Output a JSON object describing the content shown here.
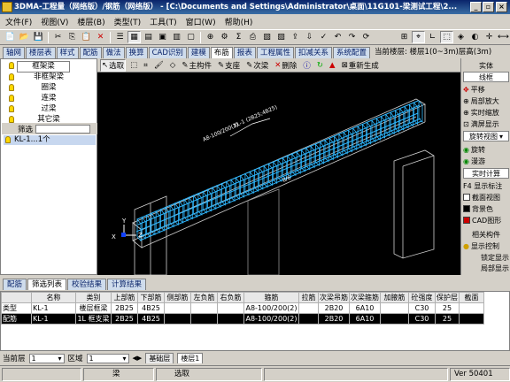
{
  "window": {
    "title": "3DMA-工程量（网络版）/钢筋（网络版） - [C:\\Documents and Settings\\Administrator\\桌面\\11G101-梁测试工程\\2...",
    "minimize": "_",
    "restore": "▫",
    "close": "×"
  },
  "menu": {
    "items": [
      "文件(F)",
      "视图(V)",
      "楼层(B)",
      "类型(T)",
      "工具(T)",
      "窗口(W)",
      "帮助(H)"
    ]
  },
  "module_tabs": [
    "轴网",
    "楼层表",
    "样式",
    "配筋",
    "做法",
    "换算",
    "CAD识别",
    "建模",
    "布筋",
    "报表",
    "工程属性",
    "扣减关系",
    "系统配置"
  ],
  "module_tab_active": "布筋",
  "floor_info": "当前楼层: 楼层1(0~3m)层高(3m)",
  "left_panel": {
    "header": "框架梁",
    "items": [
      "非框架梁",
      "圈梁",
      "连梁",
      "过梁",
      "其它梁"
    ],
    "filter_label": "筛选",
    "selected_item": "KL-1...1个"
  },
  "draw_toolbar": {
    "select": "选取",
    "main_member": "主构件",
    "support": "支座",
    "secondary_beam": "次梁",
    "delete": "删除",
    "regenerate": "重新生成"
  },
  "viewport": {
    "labels": [
      "KL-1 (2B25;4B25)",
      "A8-100/200(2)",
      "8/6",
      "X",
      "Y",
      "Z"
    ],
    "colors": {
      "background": "#000000",
      "rebar": "#2fb8ff",
      "concrete": "#d0d0d0"
    }
  },
  "right_panel": {
    "mode": "实体",
    "wireframe": "线框",
    "pan": "平移",
    "zoom_local": "局部放大",
    "zoom_realtime": "实时缩放",
    "fit_view": "满屏显示",
    "rotate_view": "旋转视图",
    "rotate": "旋转",
    "roam": "漫游",
    "realtime_calc": "实时计算",
    "f4_label": "F4 显示标注",
    "section_view": "截面视图",
    "background": "背景色",
    "cad_graphic": "CAD图形",
    "related_member": "相关构件",
    "display_control": "显示控制",
    "lock_display": "锁定显示",
    "local_display": "局部显示"
  },
  "bottom_tabs": [
    "配筋",
    "筛选列表",
    "校验结果",
    "计算结果"
  ],
  "bottom_tab_active": "筛选列表",
  "table": {
    "headers": [
      "名称",
      "类别",
      "上部筋",
      "下部筋",
      "侧部筋",
      "左负筋",
      "右负筋",
      "箍筋",
      "拉筋",
      "次梁吊筋",
      "次梁箍筋",
      "加腋筋",
      "砼强度",
      "保护层",
      "截面"
    ],
    "rows": [
      [
        "类型",
        "KL-1",
        "楼层框梁",
        "2B25",
        "4B25",
        "",
        "",
        "",
        "A8-100/200(2)",
        "",
        "2B20",
        "6A10",
        "",
        "C30",
        "25",
        ""
      ],
      [
        "配筋",
        "KL-1",
        "1L 框支梁",
        "2B25",
        "4B25",
        "",
        "",
        "",
        "A8-100/200(2)",
        "",
        "2B20",
        "6A10",
        "",
        "C30",
        "25",
        ""
      ]
    ]
  },
  "floor_bar": {
    "label": "当前层",
    "floor_value": "1",
    "zone_label": "区域",
    "zone_value": "1",
    "tabs": [
      "基础层",
      "楼层1"
    ]
  },
  "status_bar": {
    "member": "梁",
    "action": "选取",
    "version": "Ver 50401"
  }
}
